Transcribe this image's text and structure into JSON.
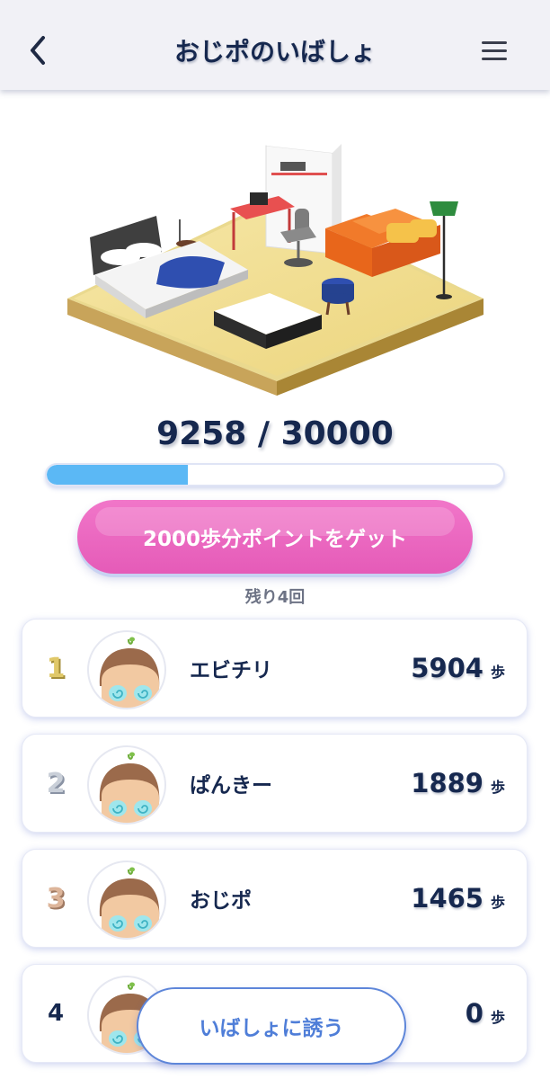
{
  "header": {
    "title": "おじポのいばしょ",
    "back_icon": "chevron-left-icon",
    "menu_icon": "hamburger-menu-icon"
  },
  "progress": {
    "current": "9258",
    "separator": " / ",
    "goal": "30000",
    "fraction": 0.3086,
    "fill_color": "#5bb8f5"
  },
  "get_button": {
    "label": "2000歩分ポイントをゲット",
    "color": "#e55bb8"
  },
  "remaining": "残り4回",
  "ranking": [
    {
      "rank": "1",
      "name": "エビチリ",
      "steps": "5904",
      "unit": "歩",
      "medal": "gold"
    },
    {
      "rank": "2",
      "name": "ぱんきー",
      "steps": "1889",
      "unit": "歩",
      "medal": "silver"
    },
    {
      "rank": "3",
      "name": "おじポ",
      "steps": "1465",
      "unit": "歩",
      "medal": "bronze"
    },
    {
      "rank": "4",
      "name": "",
      "steps": "0",
      "unit": "歩",
      "medal": "none"
    }
  ],
  "invite_button": {
    "label": "いばしょに誘う"
  }
}
